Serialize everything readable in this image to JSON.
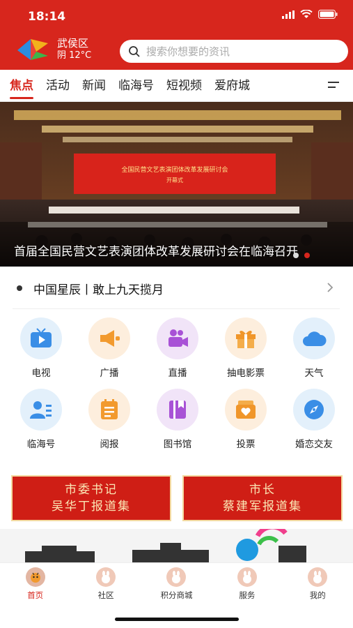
{
  "status_bar": {
    "time": "18:14"
  },
  "location": {
    "district": "武侯区",
    "weather": "阴 12°C"
  },
  "search": {
    "placeholder": "搜索你想要的资讯"
  },
  "tabs": [
    "焦点",
    "活动",
    "新闻",
    "临海号",
    "短视频",
    "爱府城"
  ],
  "banner": {
    "caption": "首届全国民营文艺表演团体改革发展研讨会在临海召开",
    "slide_title": "全国民营文艺表演团体改革发展研讨会",
    "slide_sub": "开幕式",
    "active_dot": 2
  },
  "notice": {
    "text": "中国星辰丨敢上九天揽月"
  },
  "services": [
    {
      "label": "电视",
      "icon": "tv-icon"
    },
    {
      "label": "广播",
      "icon": "broadcast-icon"
    },
    {
      "label": "直播",
      "icon": "video-camera-icon"
    },
    {
      "label": "抽电影票",
      "icon": "gift-icon"
    },
    {
      "label": "天气",
      "icon": "cloud-icon"
    },
    {
      "label": "临海号",
      "icon": "user-list-icon"
    },
    {
      "label": "阅报",
      "icon": "newspaper-icon"
    },
    {
      "label": "图书馆",
      "icon": "book-icon"
    },
    {
      "label": "投票",
      "icon": "heart-box-icon"
    },
    {
      "label": "婚恋交友",
      "icon": "compass-icon"
    }
  ],
  "cards": [
    {
      "line1": "市委书记",
      "line2": "吴华丁报道集"
    },
    {
      "line1": "市长",
      "line2": "蔡建军报道集"
    }
  ],
  "bottom_nav": [
    "首页",
    "社区",
    "积分商城",
    "服务",
    "我的"
  ],
  "colors": {
    "brand": "#d7261d",
    "card_text": "#fbe7b5"
  }
}
